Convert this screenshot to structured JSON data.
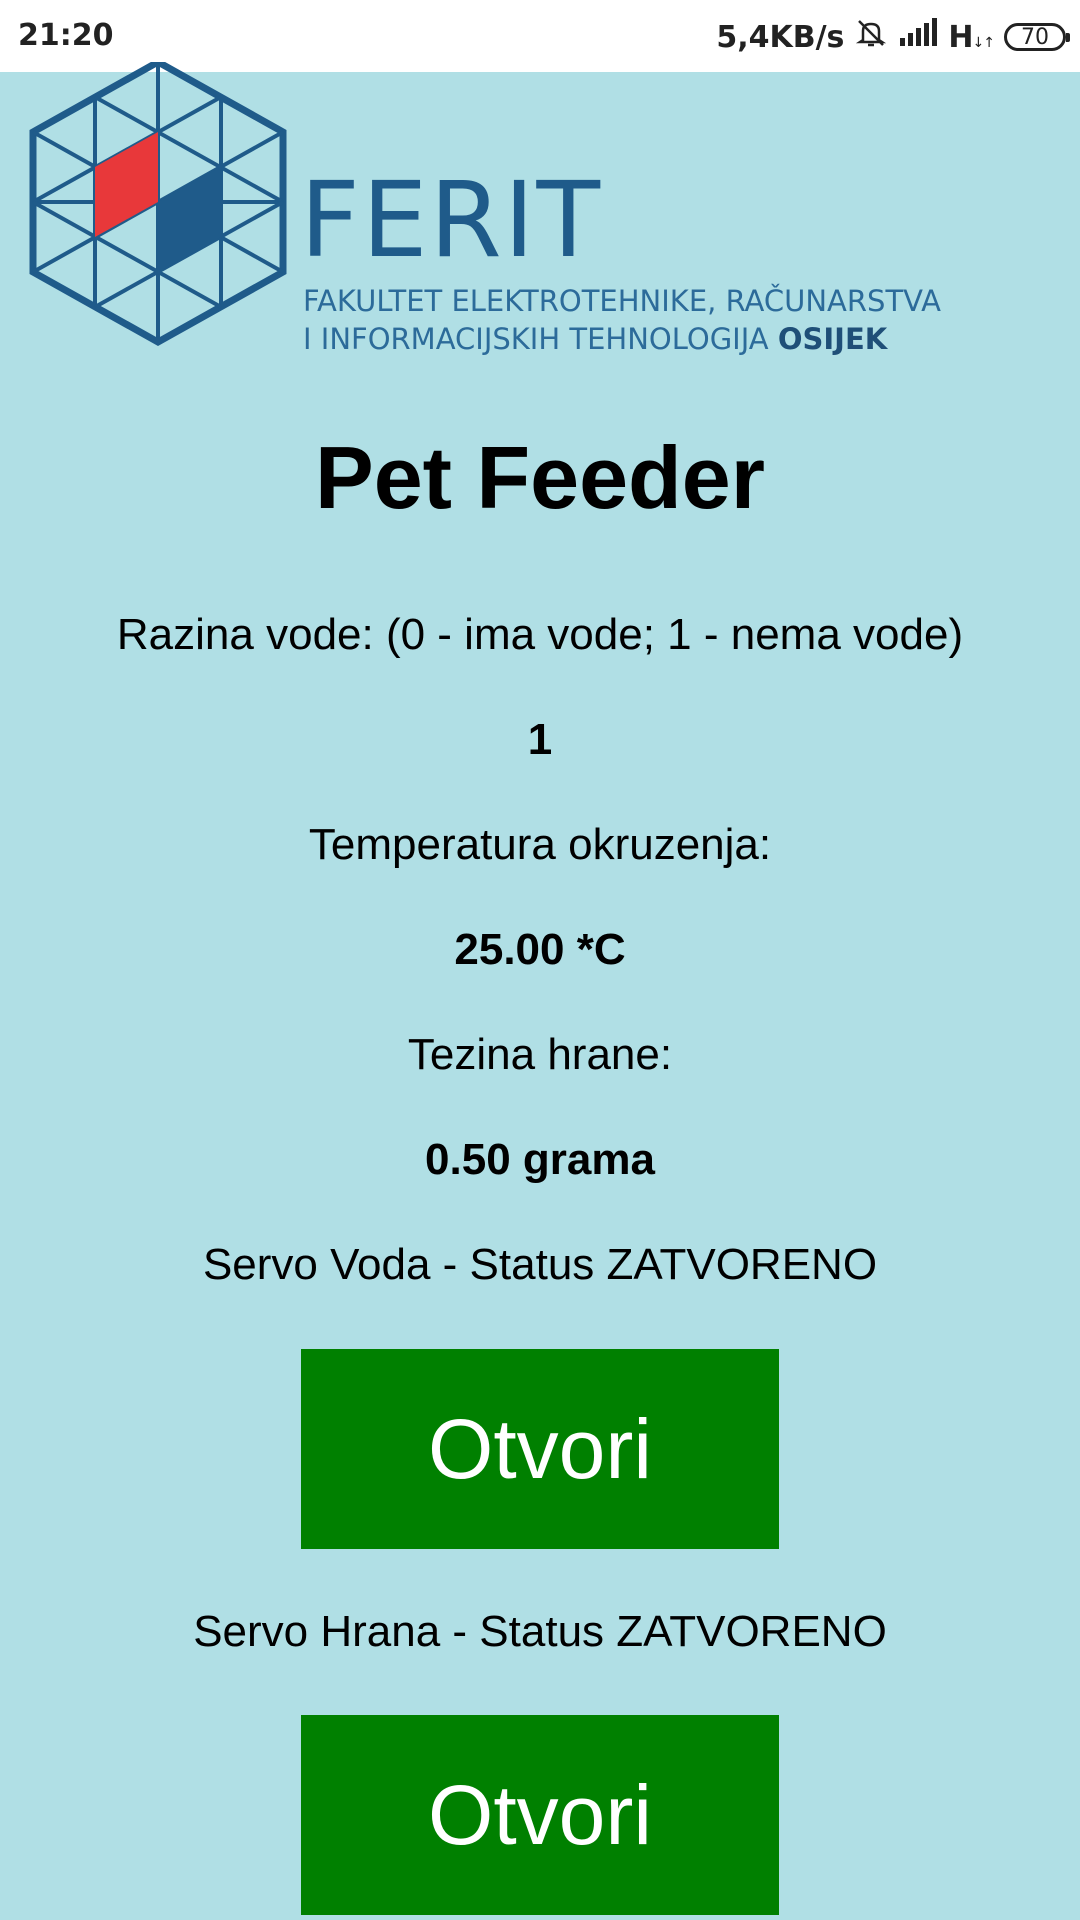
{
  "status_bar": {
    "time": "21:20",
    "speed": "5,4KB/s",
    "network": "H",
    "battery": "70"
  },
  "logo": {
    "wordmark": "FERIT",
    "line1": "FAKULTET ELEKTROTEHNIKE, RAČUNARSTVA",
    "line2": "I INFORMACIJSKIH TEHNOLOGIJA",
    "line2_bold": "OSIJEK",
    "colors": {
      "blue": "#1f5b8a",
      "red": "#e8383a"
    }
  },
  "main": {
    "title": "Pet Feeder",
    "water_label": "Razina vode: (0 - ima vode; 1 - nema vode)",
    "water_value": "1",
    "temp_label": "Temperatura okruzenja:",
    "temp_value": "25.00 *C",
    "weight_label": "Tezina hrane:",
    "weight_value": "0.50 grama",
    "servo_water_status": "Servo Voda - Status ZATVORENO",
    "servo_water_button": "Otvori",
    "servo_food_status": "Servo Hrana - Status ZATVORENO",
    "servo_food_button": "Otvori"
  },
  "colors": {
    "background": "#b0dfe5",
    "button": "#008000",
    "button_text": "#ffffff"
  }
}
